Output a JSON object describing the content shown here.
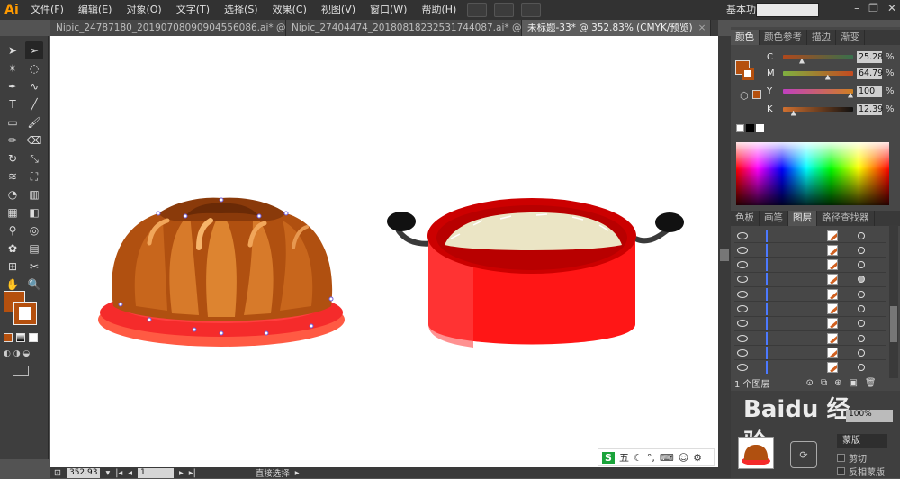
{
  "app": {
    "logo": "Ai",
    "workspace": "基本功能 ▾"
  },
  "menu": [
    "文件(F)",
    "编辑(E)",
    "对象(O)",
    "文字(T)",
    "选择(S)",
    "效果(C)",
    "视图(V)",
    "窗口(W)",
    "帮助(H)"
  ],
  "window_buttons": [
    "–",
    "❐",
    "✕"
  ],
  "tabs": [
    {
      "title": "Nipic_24787180_20190708090904556086.ai* @ 24...",
      "close": "×"
    },
    {
      "title": "Nipic_27404474_20180818232531744087.ai* @ 15...",
      "close": "×"
    },
    {
      "title": "未标题-33* @ 352.83% (CMYK/预览)",
      "close": "×"
    }
  ],
  "status": {
    "zoom": "352.93",
    "page": "1",
    "tool": "直接选择"
  },
  "color_panel": {
    "tabs": [
      "颜色",
      "颜色参考",
      "描边",
      "渐变"
    ],
    "sliders": [
      {
        "label": "C",
        "value": "25.28",
        "unit": "%",
        "level": 0.25,
        "gradient": "linear-gradient(to right,#b0481c,#37704c)"
      },
      {
        "label": "M",
        "value": "64.79",
        "unit": "%",
        "level": 0.65,
        "gradient": "linear-gradient(to right,#7fb040,#c44a20)"
      },
      {
        "label": "Y",
        "value": "100",
        "unit": "%",
        "level": 1.0,
        "gradient": "linear-gradient(to right,#c040c0,#d08020)"
      },
      {
        "label": "K",
        "value": "12.39",
        "unit": "%",
        "level": 0.12,
        "gradient": "linear-gradient(to right,#d07030,#101010)"
      }
    ],
    "fill_color": "#b5500e"
  },
  "layers_panel": {
    "tabs": [
      "色板",
      "画笔",
      "图层",
      "路径查找器"
    ],
    "rows": 10,
    "footer": "1 个图层"
  },
  "watermark": {
    "text": "Baidu 经验"
  },
  "sub_panel": {
    "items": [
      "蒙版",
      "剪切",
      "反相蒙版"
    ],
    "percent": "100%"
  },
  "ime": {
    "label": "五"
  }
}
